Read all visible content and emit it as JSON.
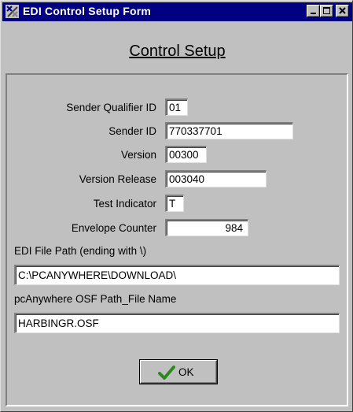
{
  "window": {
    "title": "EDI Control Setup Form",
    "icon": "app-icon",
    "controls": [
      "minimize-icon",
      "maximize-icon",
      "close-icon"
    ]
  },
  "form": {
    "heading": "Control Setup",
    "fields": {
      "sender_qualifier_id": {
        "label": "Sender Qualifier ID",
        "value": "01"
      },
      "sender_id": {
        "label": "Sender ID",
        "value": "770337701"
      },
      "version": {
        "label": "Version",
        "value": "00300"
      },
      "version_release": {
        "label": "Version Release",
        "value": "003040"
      },
      "test_indicator": {
        "label": "Test Indicator",
        "value": "T"
      },
      "envelope_counter": {
        "label": "Envelope Counter",
        "value": "984"
      },
      "edi_file_path": {
        "label": "EDI File Path (ending with \\)",
        "value": "C:\\PCANYWHERE\\DOWNLOAD\\"
      },
      "osf_path": {
        "label": "pcAnywhere OSF Path_File Name",
        "value": "HARBINGR.OSF"
      }
    },
    "ok_button": {
      "label": "OK",
      "icon": "checkmark-icon"
    }
  },
  "colors": {
    "titlebar": "#000080",
    "face": "#c0c0c0",
    "check": "#2a8a1a"
  }
}
